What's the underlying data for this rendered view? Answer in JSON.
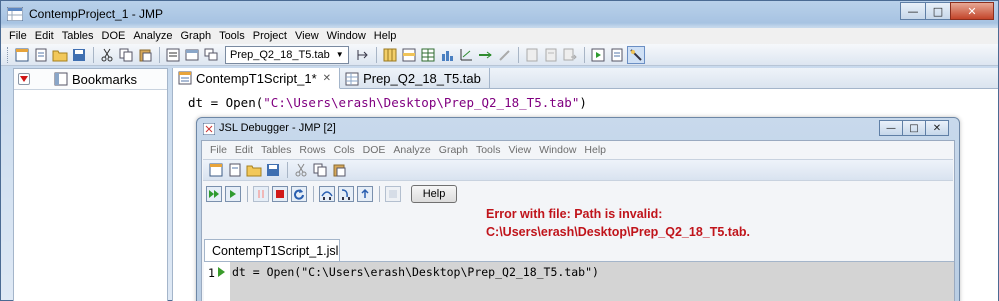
{
  "window": {
    "title": "ContempProject_1 - JMP"
  },
  "menubar": [
    "File",
    "Edit",
    "Tables",
    "DOE",
    "Analyze",
    "Graph",
    "Tools",
    "Project",
    "View",
    "Window",
    "Help"
  ],
  "toolbar": {
    "table_select": "Prep_Q2_18_T5.tab"
  },
  "left_panel": {
    "title": "Bookmarks"
  },
  "tabs": [
    {
      "label": "ContempT1Script_1*",
      "close": "✕",
      "active": true
    },
    {
      "label": "Prep_Q2_18_T5.tab",
      "active": false
    }
  ],
  "script": {
    "prefix": "dt = Open(",
    "string": "\"C:\\Users\\erash\\Desktop\\Prep_Q2_18_T5.tab\"",
    "suffix": ")"
  },
  "debugger": {
    "title": "JSL Debugger - JMP [2]",
    "menu": [
      "File",
      "Edit",
      "Tables",
      "Rows",
      "Cols",
      "DOE",
      "Analyze",
      "Graph",
      "Tools",
      "View",
      "Window",
      "Help"
    ],
    "help_label": "Help",
    "error_line1": "Error with file: Path is invalid:",
    "error_line2": "C:\\Users\\erash\\Desktop\\Prep_Q2_18_T5.tab.",
    "tab_label": "ContempT1Script_1.jsl",
    "line_number": "1",
    "code": "dt = Open(\"C:\\Users\\erash\\Desktop\\Prep_Q2_18_T5.tab\")"
  }
}
